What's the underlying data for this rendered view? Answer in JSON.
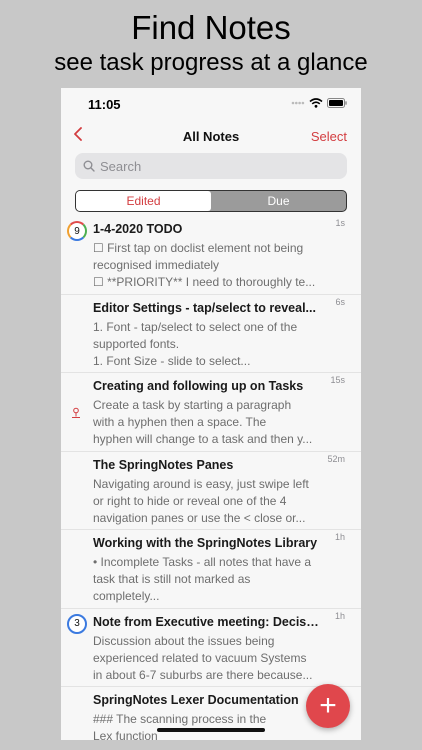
{
  "promo": {
    "headline": "Find Notes",
    "subheadline": "see task progress at a glance"
  },
  "status_bar": {
    "time": "11:05"
  },
  "nav": {
    "back_icon": "chevron-left-icon",
    "title": "All Notes",
    "select_label": "Select"
  },
  "search": {
    "placeholder": "Search"
  },
  "segments": [
    {
      "label": "Edited",
      "active": true
    },
    {
      "label": "Due",
      "active": false
    }
  ],
  "notes": [
    {
      "title": "1-4-2020 TODO",
      "lines": [
        "☐ First tap on doclist element not being",
        "recognised immediately",
        "☐ **PRIORITY** I need to thoroughly te..."
      ],
      "age": "1s",
      "badge": "9"
    },
    {
      "title": "Editor Settings  - tap/select to reveal...",
      "lines": [
        "1. Font - tap/select to select one of the",
        "supported fonts.",
        "1. Font Size - slide to select..."
      ],
      "age": "6s"
    },
    {
      "title": "Creating and following up on Tasks",
      "lines": [
        "Create a task by starting a paragraph",
        "with a  hyphen then a space.  The",
        "hyphen will change to a task and then y..."
      ],
      "age": "15s",
      "icon": "location-pin-icon"
    },
    {
      "title": "The SpringNotes Panes",
      "lines": [
        "Navigating around is easy, just swipe left",
        "or right to hide or reveal one of the 4",
        "navigation panes or use the < close  or..."
      ],
      "age": "52m"
    },
    {
      "title": "Working with the SpringNotes Library",
      "lines": [
        "• Incomplete Tasks - all notes that have a",
        "task that is still not marked as",
        "completely..."
      ],
      "age": "1h"
    },
    {
      "title": "Note from Executive meeting: Decisio...",
      "lines": [
        "Discussion about the issues being",
        "experienced related to vacuum Systems",
        "in about 6-7 suburbs are there because..."
      ],
      "age": "1h",
      "badge": "3"
    },
    {
      "title": "SpringNotes Lexer Documentation",
      "lines": [
        "### The scanning process in the",
        "Lex function"
      ],
      "age": ""
    }
  ],
  "fab": {
    "label": "+"
  },
  "colors": {
    "accent": "#d33d40",
    "fab": "#e0474c"
  }
}
